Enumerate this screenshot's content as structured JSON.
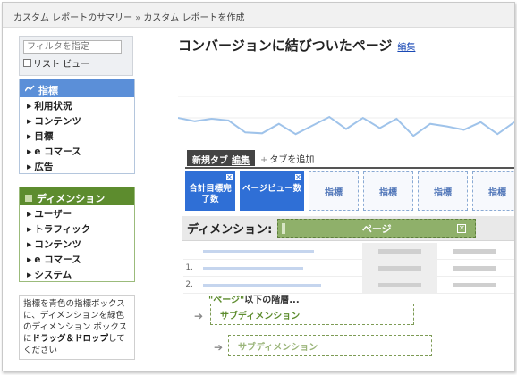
{
  "breadcrumb": {
    "parent": "カスタム レポートのサマリー",
    "separator": "»",
    "current": "カスタム レポートを作成"
  },
  "sidebar": {
    "filter_placeholder": "フィルタを指定",
    "list_view_label": "リスト ビュー",
    "metrics_panel": {
      "title": "指標",
      "items": [
        "利用状況",
        "コンテンツ",
        "目標",
        "e コマース",
        "広告"
      ]
    },
    "dimensions_panel": {
      "title": "ディメンション",
      "items": [
        "ユーザー",
        "トラフィック",
        "コンテンツ",
        "e コマース",
        "システム"
      ]
    },
    "help": {
      "line1": "指標を青色の指標ボックスに、ディメンションを緑色のディメンション ボックスに",
      "bold": "ドラッグ＆ドロップ",
      "line2": "してください"
    }
  },
  "main": {
    "title": "コンバージョンに結びついたページ",
    "edit_link": "編集",
    "tab": {
      "name": "新規タブ",
      "edit": "編集"
    },
    "add_tab": "タブを追加",
    "metrics": [
      {
        "label": "合計目標完了数",
        "filled": true
      },
      {
        "label": "ページビュー数",
        "filled": true
      },
      {
        "label": "指標",
        "filled": false
      },
      {
        "label": "指標",
        "filled": false
      },
      {
        "label": "指標",
        "filled": false
      },
      {
        "label": "指標",
        "filled": false
      }
    ],
    "dimension_label": "ディメンション:",
    "dimension_value": "ページ",
    "row_numbers": [
      "1.",
      "2."
    ],
    "below_prefix": "\"ページ\"",
    "below_suffix": "以下の階層...",
    "subdimension_1": "サブディメンション",
    "subdimension_2": "サブディメンション"
  },
  "colors": {
    "metric_blue": "#2f6fd6",
    "dimension_green": "#5d8c2e",
    "chart_line": "#9fc3ea"
  },
  "icons": {
    "metrics_header": "line-chart-icon",
    "dimension_header": "green-square-icon",
    "remove": "close-icon",
    "arrow": "right-arrow-icon"
  },
  "chart_data": {
    "type": "line",
    "series": [
      {
        "values": [
          50,
          46,
          49,
          47,
          33,
          32,
          43,
          31,
          41,
          51,
          37,
          50,
          38,
          49,
          29,
          43,
          40,
          36,
          45,
          31,
          45
        ]
      }
    ],
    "ylim": [
      0,
      100
    ],
    "grid": true
  }
}
